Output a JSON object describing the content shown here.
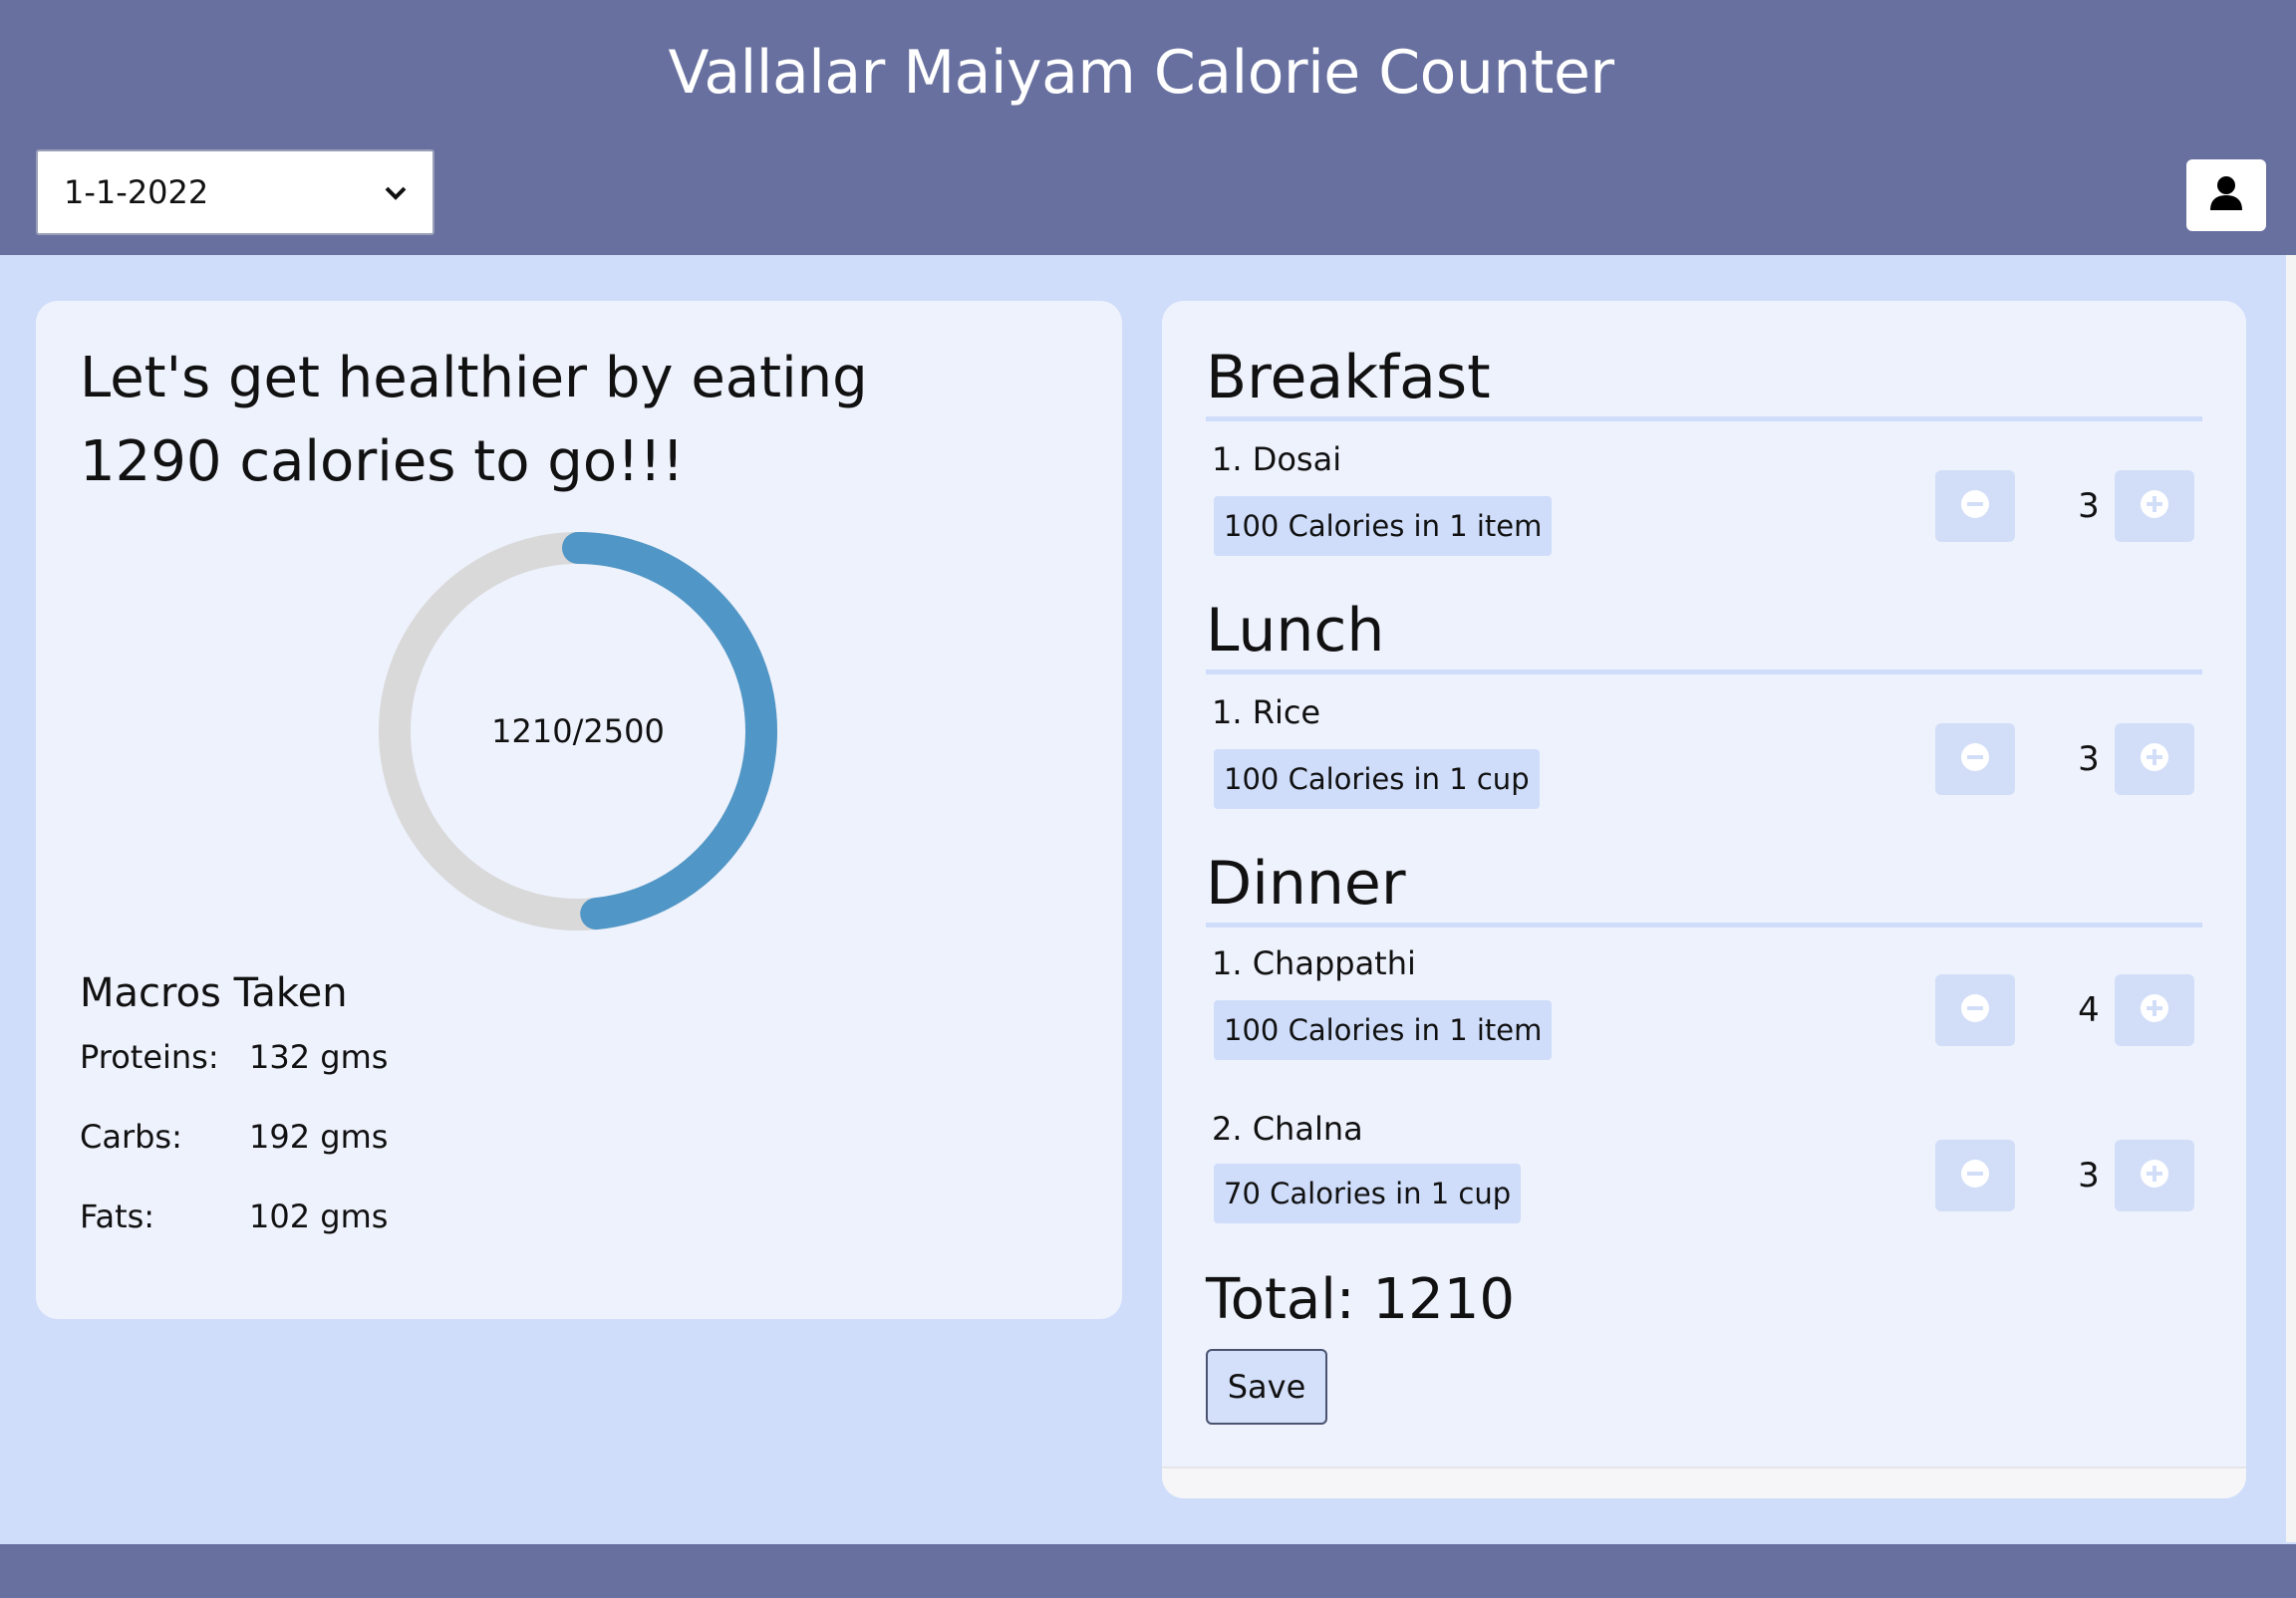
{
  "header": {
    "title": "Vallalar Maiyam Calorie Counter",
    "date_select": {
      "selected": "1-1-2022"
    },
    "user_icon": "user-icon"
  },
  "summary": {
    "line1": "Let's get healthier by eating",
    "line2": "1290 calories to go!!!",
    "progress": {
      "consumed": 1210,
      "goal": 2500,
      "label": "1210/2500"
    },
    "colors": {
      "ring_fill": "#5096c6",
      "ring_track": "#d9d9d9"
    },
    "macros_title": "Macros Taken",
    "macros": [
      {
        "label": "Proteins:",
        "value": "132 gms"
      },
      {
        "label": "Carbs:",
        "value": "192 gms"
      },
      {
        "label": "Fats:",
        "value": "102 gms"
      }
    ]
  },
  "meals": {
    "breakfast": {
      "title": "Breakfast",
      "items": [
        {
          "name": "1. Dosai",
          "calories": "100 Calories in 1 item",
          "qty": "3"
        }
      ]
    },
    "lunch": {
      "title": "Lunch",
      "items": [
        {
          "name": "1. Rice",
          "calories": "100 Calories in 1 cup",
          "qty": "3"
        }
      ]
    },
    "dinner": {
      "title": "Dinner",
      "items": [
        {
          "name": "1. Chappathi",
          "calories": "100 Calories in 1 item",
          "qty": "4"
        },
        {
          "name": "2. Chalna",
          "calories": "70 Calories in 1 cup",
          "qty": "3"
        }
      ]
    },
    "total": "Total: 1210",
    "save_label": "Save"
  }
}
